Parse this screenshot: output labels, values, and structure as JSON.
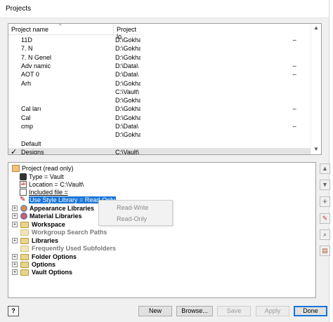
{
  "window": {
    "title": "Projects"
  },
  "project_list": {
    "columns": [
      "Project name",
      "Project lo"
    ],
    "rows": [
      {
        "name": "11D",
        "location": "D:\\Gokha",
        "ellipsis": "..."
      },
      {
        "name": "7. N",
        "location": "D:\\Gokha",
        "ellipsis": ""
      },
      {
        "name": "7. N                Genel",
        "location": "D:\\Gokha",
        "ellipsis": ""
      },
      {
        "name": "Adv              namic",
        "location": "D:\\Data\\",
        "ellipsis": "..."
      },
      {
        "name": "AOT              0",
        "location": "D:\\Data\\",
        "ellipsis": "..."
      },
      {
        "name": "Arh",
        "location": "D:\\Gokha",
        "ellipsis": ""
      },
      {
        "name": "",
        "location": "C:\\Vault\\",
        "ellipsis": ""
      },
      {
        "name": "",
        "location": "D:\\Gokha",
        "ellipsis": ""
      },
      {
        "name": "Cal              ları",
        "location": "D:\\Gokha",
        "ellipsis": "..."
      },
      {
        "name": "Cal",
        "location": "D:\\Gokha",
        "ellipsis": ""
      },
      {
        "name": "cmp",
        "location": "D:\\Data\\",
        "ellipsis": "..."
      },
      {
        "name": "",
        "location": "D:\\Gokha",
        "ellipsis": ""
      },
      {
        "name": "Default",
        "location": "",
        "ellipsis": ""
      },
      {
        "name": "Designs",
        "location": "C:\\Vault\\",
        "ellipsis": "",
        "active": true
      }
    ],
    "active_mark": "✓"
  },
  "tree": {
    "root": "Project (read only)",
    "items": [
      {
        "label": "Type = Vault"
      },
      {
        "label": "Location = C:\\Vault\\"
      },
      {
        "label": "Included file ="
      },
      {
        "label": "Use Style Library = Read-Only"
      },
      {
        "label": "Appearance Libraries"
      },
      {
        "label": "Material Libraries"
      },
      {
        "label": "Workspace"
      },
      {
        "label": "Workgroup Search Paths"
      },
      {
        "label": "Libraries"
      },
      {
        "label": "Frequently Used Subfolders"
      },
      {
        "label": "Folder Options"
      },
      {
        "label": "Options"
      },
      {
        "label": "Vault Options"
      }
    ]
  },
  "popup": {
    "options": [
      "Read-Write",
      "Read-Only"
    ]
  },
  "buttons": {
    "help": "?",
    "new": "New",
    "browse": "Browse...",
    "save": "Save",
    "apply": "Apply",
    "done": "Done"
  },
  "colors": {
    "selection": "#1874d6",
    "folder": "#e8d48a"
  }
}
